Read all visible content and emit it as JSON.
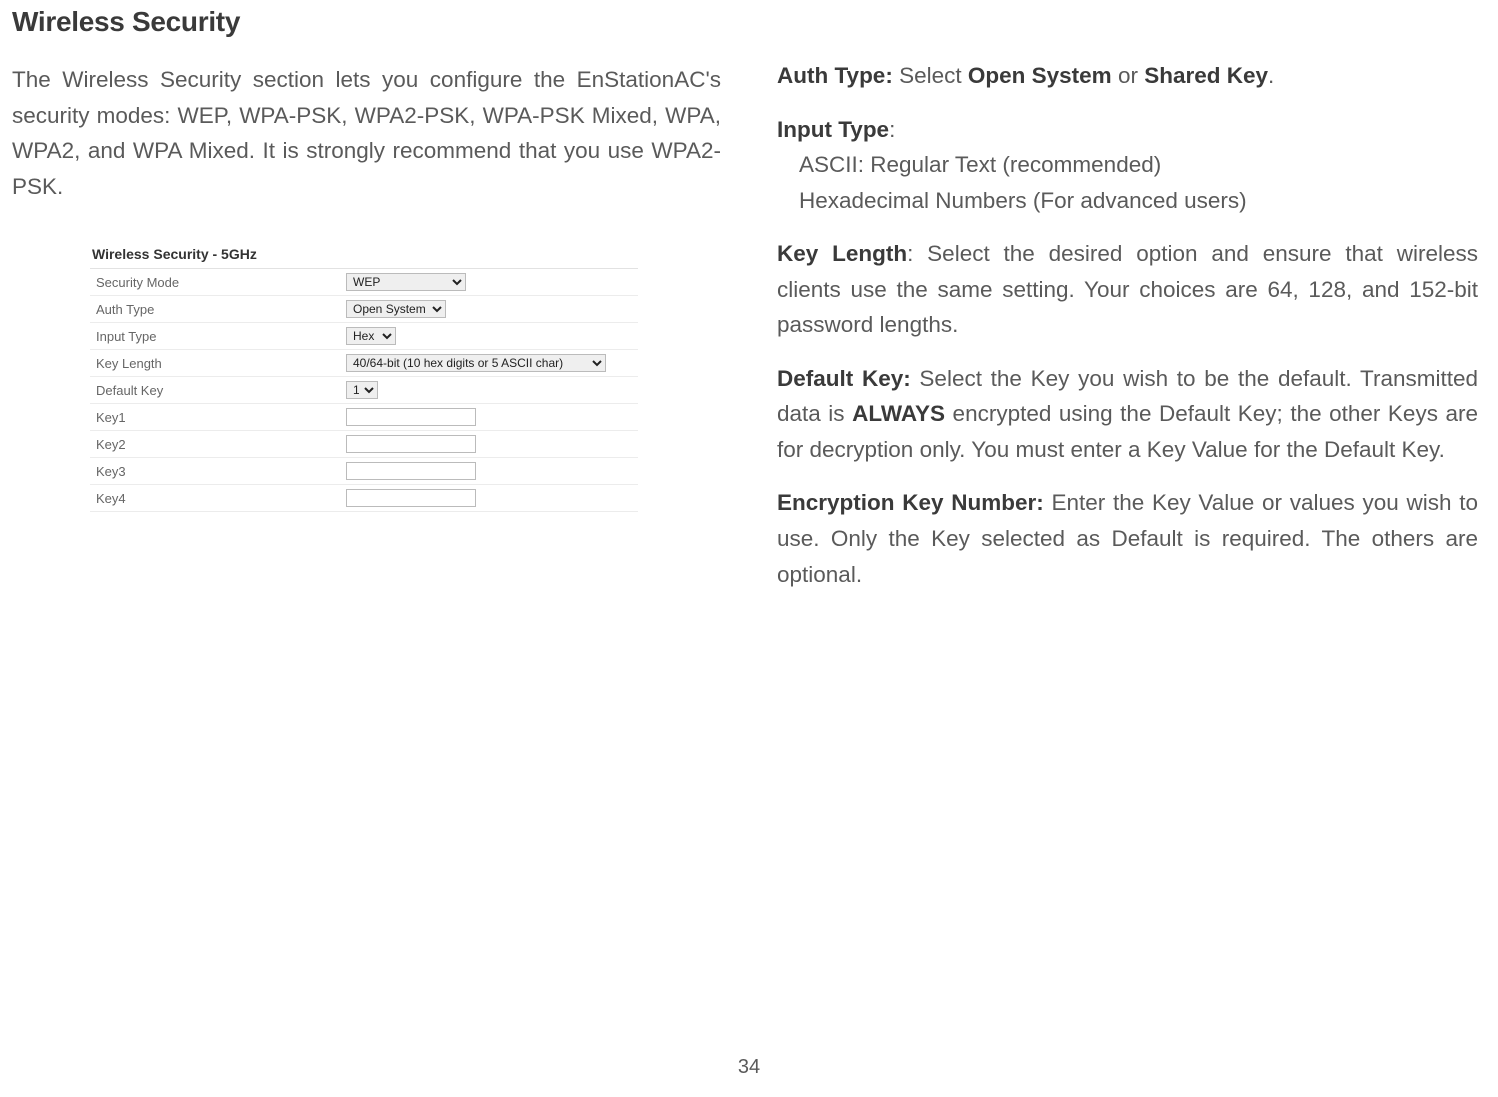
{
  "heading": "Wireless Security",
  "intro": "The Wireless Security section lets you configure the EnStationAC's security modes: WEP, WPA-PSK, WPA2-PSK, WPA-PSK Mixed, WPA, WPA2, and WPA Mixed. It is strongly recommend that you use WPA2-PSK.",
  "screenshot": {
    "title": "Wireless Security - 5GHz",
    "rows": {
      "security_mode": {
        "label": "Security Mode",
        "value": "WEP"
      },
      "auth_type": {
        "label": "Auth Type",
        "value": "Open System"
      },
      "input_type": {
        "label": "Input Type",
        "value": "Hex"
      },
      "key_length": {
        "label": "Key Length",
        "value": "40/64-bit (10 hex digits or 5 ASCII char)"
      },
      "default_key": {
        "label": "Default Key",
        "value": "1"
      },
      "key1": {
        "label": "Key1",
        "value": ""
      },
      "key2": {
        "label": "Key2",
        "value": ""
      },
      "key3": {
        "label": "Key3",
        "value": ""
      },
      "key4": {
        "label": "Key4",
        "value": ""
      }
    }
  },
  "right": {
    "auth_type_label": "Auth Type: ",
    "auth_type_text1": "Select ",
    "auth_type_b1": "Open System",
    "auth_type_text2": " or ",
    "auth_type_b2": "Shared Key",
    "auth_type_text3": ".",
    "input_type_label": "Input Type",
    "input_type_colon": ":",
    "input_type_line1": "ASCII: Regular Text (recommended)",
    "input_type_line2": "Hexadecimal Numbers (For advanced users)",
    "key_length_label": "Key Length",
    "key_length_text": ": Select the desired option and ensure that wireless clients use the same setting. Your choices are 64, 128, and 152-bit password lengths.",
    "default_key_label": "Default Key: ",
    "default_key_text1": "Select the Key you wish to be the default. Transmitted data is ",
    "default_key_b": "ALWAYS",
    "default_key_text2": " encrypted using the Default Key; the other Keys are for decryption only. You must enter a Key Value for the Default Key.",
    "enc_key_label": "Encryption Key Number: ",
    "enc_key_text": "Enter the Key Value or values you wish to use. Only the Key selected as Default is required. The others are optional."
  },
  "page_number": "34"
}
